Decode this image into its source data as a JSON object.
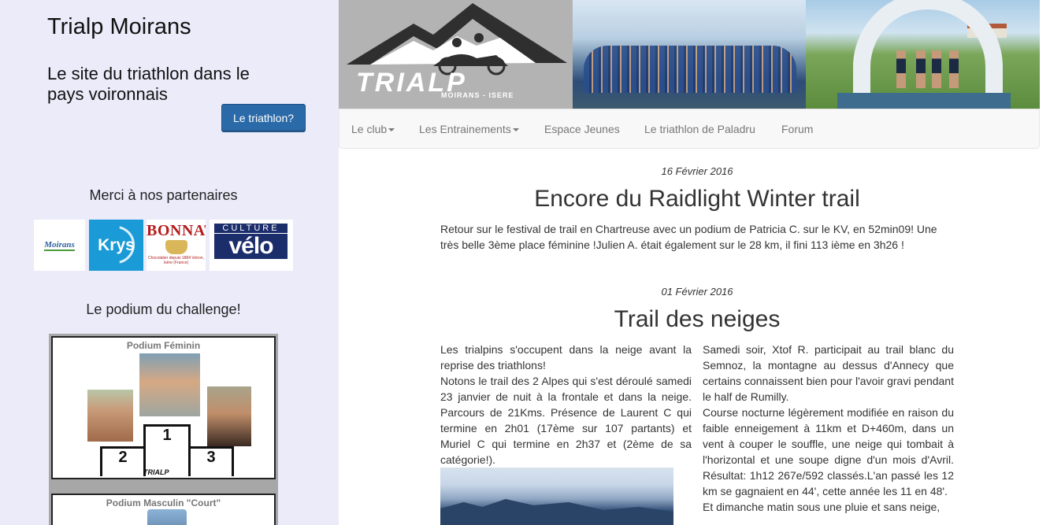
{
  "sidebar": {
    "site_title": "Trialp Moirans",
    "site_subtitle": "Le site du triathlon dans le pays voironnais",
    "triathlon_button": "Le triathlon?",
    "partners_title": "Merci à nos partenaires",
    "partners": [
      {
        "name": "Moirans",
        "text": "Moirans"
      },
      {
        "name": "Krys",
        "text": "Krys"
      },
      {
        "name": "Bonnat",
        "text": "BONNAT",
        "subtext": "Chocolatier depuis 1884 Voiron, Isère (France)"
      },
      {
        "name": "Culture Vélo",
        "text1": "CULTURE",
        "text2": "vélo"
      }
    ],
    "podium_title": "Le podium du challenge!",
    "podium": {
      "feminin_title": "Podium Féminin",
      "places": [
        "1",
        "2",
        "3"
      ],
      "logo_text": "TRIALP",
      "masculin_title": "Podium Masculin \"Court\""
    }
  },
  "banner": {
    "logo_word": "TRIALP",
    "logo_place": "MOIRANS - ISERE"
  },
  "nav": {
    "items": [
      {
        "label": "Le club",
        "dropdown": true
      },
      {
        "label": "Les Entrainements",
        "dropdown": true
      },
      {
        "label": "Espace Jeunes",
        "dropdown": false
      },
      {
        "label": "Le triathlon de Paladru",
        "dropdown": false
      },
      {
        "label": "Forum",
        "dropdown": false
      }
    ]
  },
  "posts": [
    {
      "date": "16 Février 2016",
      "title": "Encore du Raidlight Winter trail",
      "body": "Retour sur le festival de trail en Chartreuse avec un podium de Patricia C. sur le KV, en 52min09! Une très belle 3ème place féminine !Julien A. était également sur le 28 km, il fini 113 ième en 3h26 !"
    },
    {
      "date": "01 Février 2016",
      "title": "Trail des neiges",
      "left_paragraphs": [
        "Les trialpins s'occupent dans la neige avant la reprise des triathlons!",
        "Notons le trail des 2 Alpes qui s'est déroulé samedi 23 janvier de nuit à la frontale et dans la neige. Parcours de 21Kms. Présence de Laurent C qui termine en 2h01 (17ème sur 107 partants) et Muriel C qui termine en 2h37 et (2ème de sa catégorie!)."
      ],
      "right_paragraphs": [
        "Samedi soir, Xtof R. participait au trail blanc du Semnoz, la montagne au dessus d'Annecy que certains connaissent bien pour l'avoir gravi pendant le half de Rumilly.",
        "Course nocturne légèrement modifiée en raison du faible enneigement à 11km et D+460m, dans un vent à couper le souffle, une neige qui tombait à l'horizontal et une soupe digne d'un mois d'Avril. Résultat: 1h12 267e/592 classés.L'an passé les 12 km se gagnaient en 44', cette année les 11 en 48'.",
        "Et dimanche matin sous une pluie et sans neige,"
      ]
    }
  ],
  "colors": {
    "sidebar_bg": "#ebebfa",
    "button_bg": "#2b6aa8",
    "nav_bg": "#f8f8f8",
    "nav_text": "#777777",
    "text": "#333333"
  }
}
